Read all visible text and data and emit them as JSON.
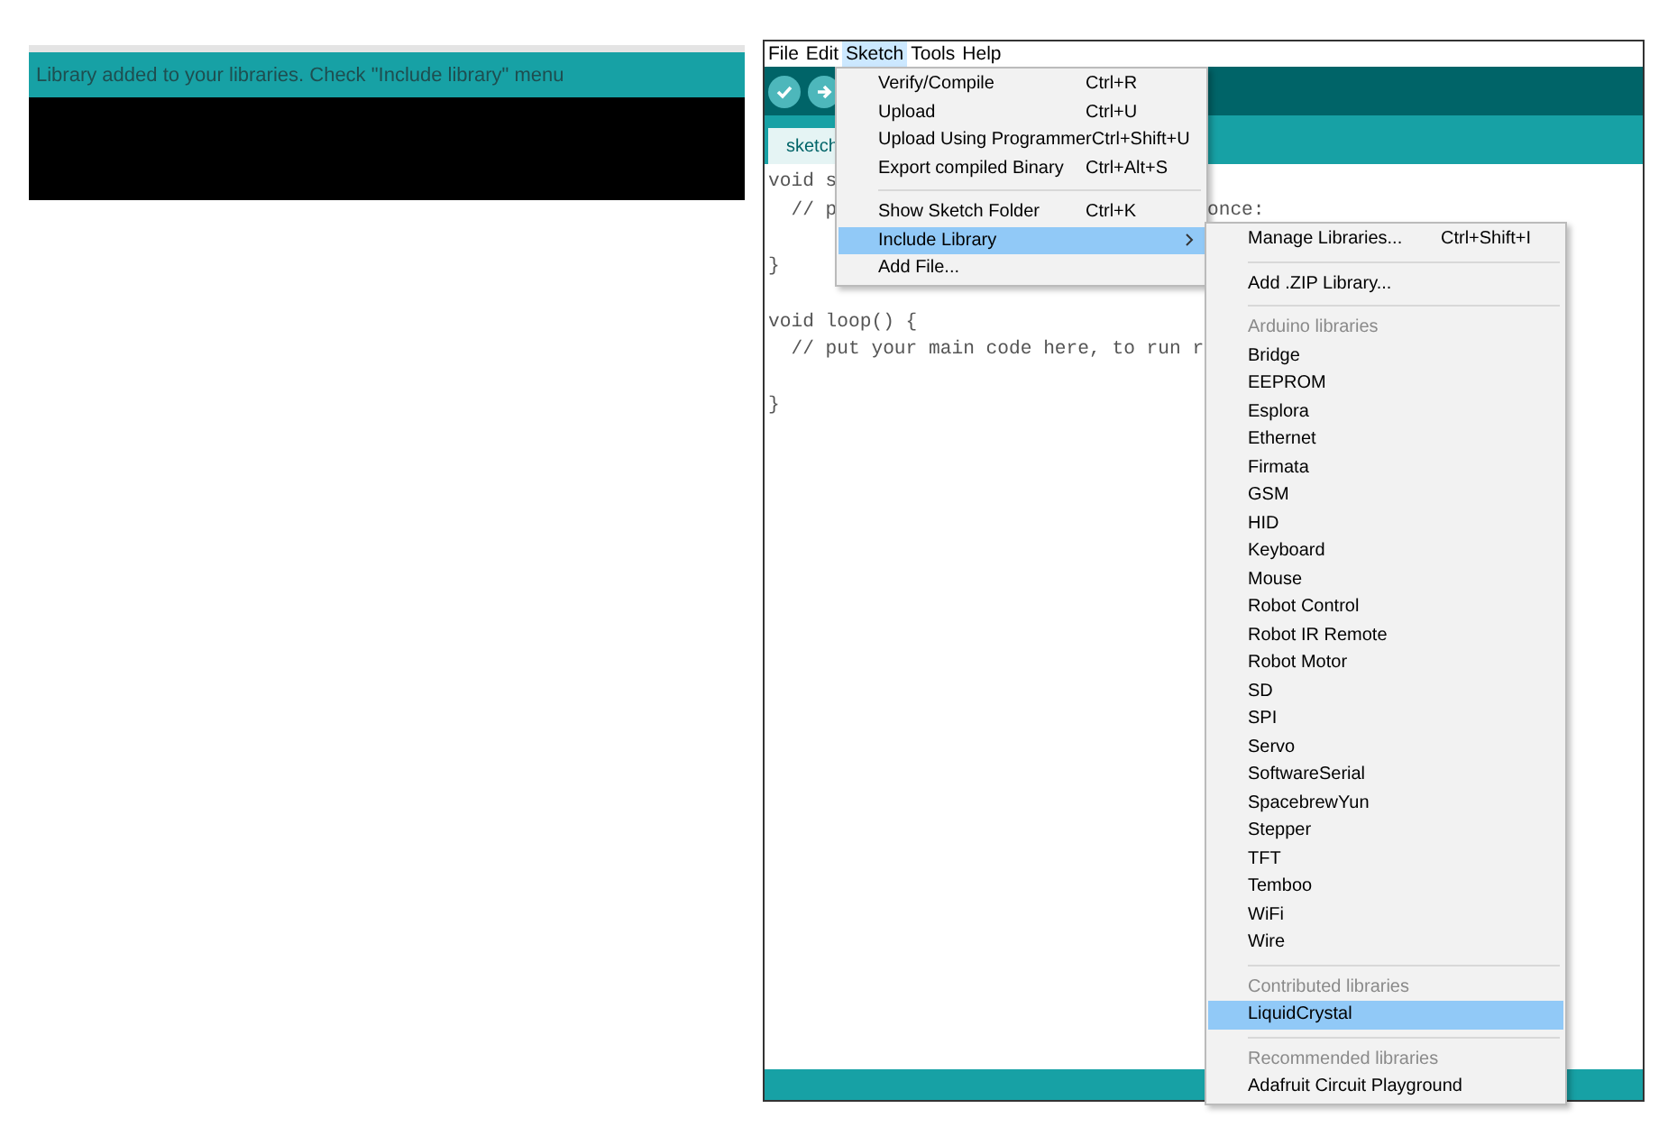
{
  "notification": {
    "message": "Library added to your libraries. Check \"Include library\" menu"
  },
  "ide": {
    "menu_bar": [
      {
        "label": "File",
        "selected": false
      },
      {
        "label": "Edit",
        "selected": false
      },
      {
        "label": "Sketch",
        "selected": true
      },
      {
        "label": "Tools",
        "selected": false
      },
      {
        "label": "Help",
        "selected": false
      }
    ],
    "tab": {
      "label": "sketch"
    },
    "code_blocks": [
      [
        {
          "text": "void s"
        },
        {
          "text": "  // p",
          "tail": "once:"
        }
      ],
      [
        {
          "text": "}"
        }
      ],
      [
        {
          "text": "void loop() {"
        },
        {
          "text": "  // put your main code here, to run r"
        }
      ],
      [
        {
          "text": "}"
        }
      ]
    ],
    "sketch_menu": [
      {
        "kind": "item",
        "label": "Verify/Compile",
        "shortcut": "Ctrl+R",
        "selected": false
      },
      {
        "kind": "item",
        "label": "Upload",
        "shortcut": "Ctrl+U",
        "selected": false
      },
      {
        "kind": "item",
        "label": "Upload Using Programmer",
        "shortcut": "Ctrl+Shift+U",
        "selected": false
      },
      {
        "kind": "item",
        "label": "Export compiled Binary",
        "shortcut": "Ctrl+Alt+S",
        "selected": false
      },
      {
        "kind": "separator"
      },
      {
        "kind": "item",
        "label": "Show Sketch Folder",
        "shortcut": "Ctrl+K",
        "selected": false
      },
      {
        "kind": "submenu",
        "label": "Include Library",
        "selected": true
      },
      {
        "kind": "item",
        "label": "Add File...",
        "selected": false
      }
    ],
    "library_menu": [
      {
        "kind": "item",
        "label": "Manage Libraries...",
        "shortcut": "Ctrl+Shift+I",
        "selected": false
      },
      {
        "kind": "separator"
      },
      {
        "kind": "item",
        "label": "Add .ZIP Library...",
        "selected": false
      },
      {
        "kind": "separator"
      },
      {
        "kind": "header",
        "label": "Arduino libraries"
      },
      {
        "kind": "item",
        "label": "Bridge",
        "selected": false
      },
      {
        "kind": "item",
        "label": "EEPROM",
        "selected": false
      },
      {
        "kind": "item",
        "label": "Esplora",
        "selected": false
      },
      {
        "kind": "item",
        "label": "Ethernet",
        "selected": false
      },
      {
        "kind": "item",
        "label": "Firmata",
        "selected": false
      },
      {
        "kind": "item",
        "label": "GSM",
        "selected": false
      },
      {
        "kind": "item",
        "label": "HID",
        "selected": false
      },
      {
        "kind": "item",
        "label": "Keyboard",
        "selected": false
      },
      {
        "kind": "item",
        "label": "Mouse",
        "selected": false
      },
      {
        "kind": "item",
        "label": "Robot Control",
        "selected": false
      },
      {
        "kind": "item",
        "label": "Robot IR Remote",
        "selected": false
      },
      {
        "kind": "item",
        "label": "Robot Motor",
        "selected": false
      },
      {
        "kind": "item",
        "label": "SD",
        "selected": false
      },
      {
        "kind": "item",
        "label": "SPI",
        "selected": false
      },
      {
        "kind": "item",
        "label": "Servo",
        "selected": false
      },
      {
        "kind": "item",
        "label": "SoftwareSerial",
        "selected": false
      },
      {
        "kind": "item",
        "label": "SpacebrewYun",
        "selected": false
      },
      {
        "kind": "item",
        "label": "Stepper",
        "selected": false
      },
      {
        "kind": "item",
        "label": "TFT",
        "selected": false
      },
      {
        "kind": "item",
        "label": "Temboo",
        "selected": false
      },
      {
        "kind": "item",
        "label": "WiFi",
        "selected": false
      },
      {
        "kind": "item",
        "label": "Wire",
        "selected": false
      },
      {
        "kind": "separator"
      },
      {
        "kind": "header",
        "label": "Contributed libraries"
      },
      {
        "kind": "item",
        "label": "LiquidCrystal",
        "selected": true
      },
      {
        "kind": "separator"
      },
      {
        "kind": "header",
        "label": "Recommended libraries"
      },
      {
        "kind": "item",
        "label": "Adafruit Circuit Playground",
        "selected": false
      }
    ]
  }
}
